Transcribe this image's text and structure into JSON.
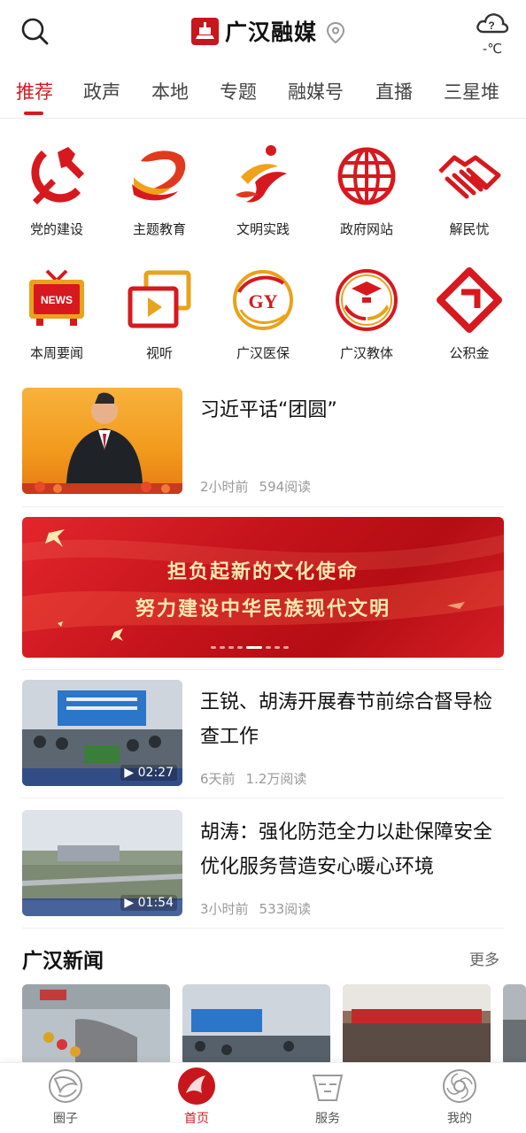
{
  "header": {
    "logo_text": "广汉融媒",
    "weather_temp": "-℃",
    "weather_symbol": "?"
  },
  "tabs": [
    {
      "label": "推荐",
      "active": true
    },
    {
      "label": "政声"
    },
    {
      "label": "本地"
    },
    {
      "label": "专题"
    },
    {
      "label": "融媒号"
    },
    {
      "label": "直播"
    },
    {
      "label": "三星堆"
    }
  ],
  "grid": [
    {
      "label": "党的建设",
      "icon": "party-emblem-icon"
    },
    {
      "label": "主题教育",
      "icon": "theme-education-icon"
    },
    {
      "label": "文明实践",
      "icon": "civilization-practice-icon"
    },
    {
      "label": "政府网站",
      "icon": "globe-icon"
    },
    {
      "label": "解民忧",
      "icon": "handshake-icon"
    },
    {
      "label": "本周要闻",
      "icon": "tv-news-icon"
    },
    {
      "label": "视听",
      "icon": "video-play-icon"
    },
    {
      "label": "广汉医保",
      "icon": "medical-insurance-icon"
    },
    {
      "label": "广汉教体",
      "icon": "education-sports-icon"
    },
    {
      "label": "公积金",
      "icon": "housing-fund-icon"
    }
  ],
  "grid_icon_text": {
    "news": "NEWS",
    "gy": "GY"
  },
  "news": [
    {
      "title": "习近平话“团圆”",
      "time": "2小时前",
      "reads": "594阅读"
    },
    {
      "title": "王锐、胡涛开展春节前综合督导检查工作",
      "time": "6天前",
      "reads": "1.2万阅读",
      "duration": "02:27"
    },
    {
      "title": "胡涛：强化防范全力以赴保障安全 优化服务营造安心暖心环境",
      "time": "3小时前",
      "reads": "533阅读",
      "duration": "01:54"
    }
  ],
  "banner": {
    "line1": "担负起新的文化使命",
    "line2": "努力建设中华民族现代文明"
  },
  "section": {
    "title": "广汉新闻",
    "more": "更多"
  },
  "bottom_nav": [
    {
      "label": "圈子"
    },
    {
      "label": "首页",
      "active": true
    },
    {
      "label": "服务"
    },
    {
      "label": "我的"
    }
  ],
  "colors": {
    "accent": "#d7191f",
    "banner_text": "#ffe9b0"
  }
}
